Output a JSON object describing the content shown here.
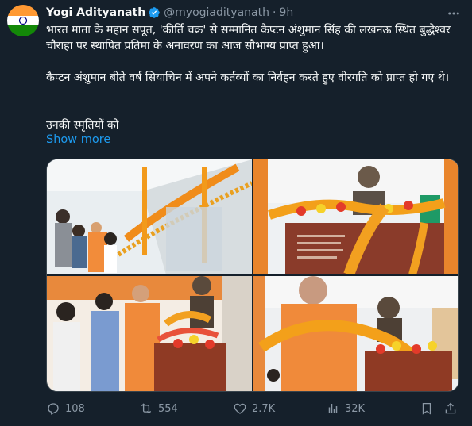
{
  "tweet": {
    "display_name": "Yogi Adityanath",
    "handle": "@myogiadityanath",
    "separator": "·",
    "time": "9h",
    "paragraph1": "भारत माता के महान सपूत, 'कीर्ति चक्र' से सम्मानित कैप्टन अंशुमान सिंह की लखनऊ स्थित बुद्धेश्वर चौराहा पर स्थापित प्रतिमा के अनावरण का आज सौभाग्य प्राप्त हुआ।",
    "paragraph2": "कैप्टन अंशुमान बीते वर्ष सियाचिन में अपने कर्तव्यों का निर्वहन करते हुए वीरगति को प्राप्त हो गए थे।",
    "paragraph3": "उनकी स्मृतियों को",
    "show_more": "Show more"
  },
  "media": [
    {
      "name": "photo-1",
      "description": "people looking at statue under garlands"
    },
    {
      "name": "photo-2",
      "description": "bust statue with flowers"
    },
    {
      "name": "photo-3",
      "description": "garlanding the statue"
    },
    {
      "name": "photo-4",
      "description": "man garlanding bust"
    }
  ],
  "actions": {
    "reply_count": "108",
    "retweet_count": "554",
    "like_count": "2.7K",
    "views_count": "32K"
  },
  "colors": {
    "background": "#15202b",
    "accent": "#1d9bf0",
    "muted": "#8b98a5",
    "text": "#f7f9f9"
  }
}
